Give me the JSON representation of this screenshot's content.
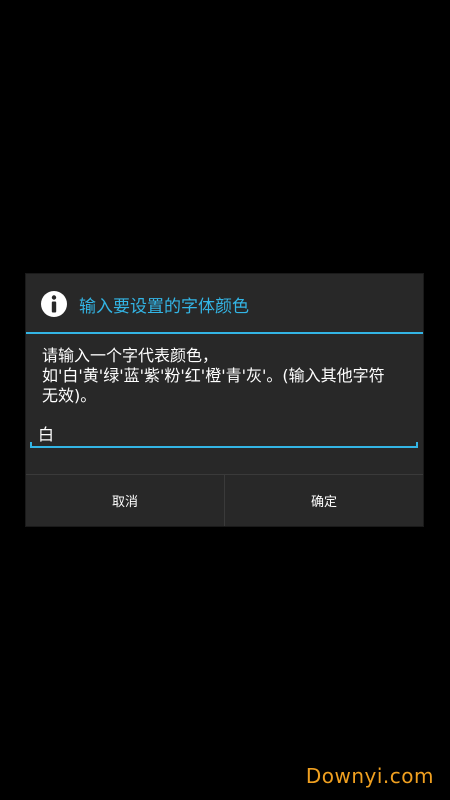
{
  "dialog": {
    "icon": "info-icon",
    "title": "输入要设置的字体颜色",
    "message_lines": [
      "请输入一个字代表颜色，",
      "如'白'黄'绿'蓝'紫'粉'红'橙'青'灰'。(输入其他字符",
      "无效)。"
    ],
    "input_value": "白",
    "cancel_label": "取消",
    "confirm_label": "确定"
  },
  "watermark": "Downyi.com",
  "colors": {
    "accent": "#33b5e5",
    "dialog_bg": "#282828",
    "screen_bg": "#000000",
    "watermark": "#f0a020"
  }
}
